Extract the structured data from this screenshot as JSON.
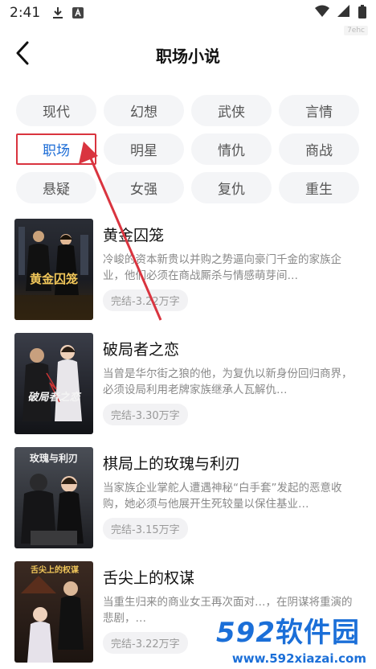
{
  "status_bar": {
    "time": "2:41",
    "watermark_tag": "7ehc"
  },
  "header": {
    "title": "职场小说"
  },
  "tags": [
    {
      "label": "现代",
      "active": false
    },
    {
      "label": "幻想",
      "active": false
    },
    {
      "label": "武侠",
      "active": false
    },
    {
      "label": "言情",
      "active": false
    },
    {
      "label": "职场",
      "active": true
    },
    {
      "label": "明星",
      "active": false
    },
    {
      "label": "情仇",
      "active": false
    },
    {
      "label": "商战",
      "active": false
    },
    {
      "label": "悬疑",
      "active": false
    },
    {
      "label": "女强",
      "active": false
    },
    {
      "label": "复仇",
      "active": false
    },
    {
      "label": "重生",
      "active": false
    }
  ],
  "books": [
    {
      "title": "黄金囚笼",
      "desc": "冷峻的资本新贵以并购之势逼向豪门千金的家族企业，他们必须在商战厮杀与情感萌芽间…",
      "status": "完结-3.22万字",
      "cover_text": "黄金囚笼"
    },
    {
      "title": "破局者之恋",
      "desc": "当曾是华尔街之狼的他，为复仇以新身份回归商界，必须设局利用老牌家族继承人瓦解仇…",
      "status": "完结-3.30万字",
      "cover_text": "破局者之恋"
    },
    {
      "title": "棋局上的玫瑰与利刃",
      "desc": "当家族企业掌舵人遭遇神秘“白手套”发起的恶意收购，她必须与他展开生死较量以保住基业…",
      "status": "完结-3.15万字",
      "cover_text": "玫瑰与利刃"
    },
    {
      "title": "舌尖上的权谋",
      "desc": "当重生归来的商业女王再次面对…，在阴谋将重演的悲剧，…",
      "status": "完结-3.22万字",
      "cover_text": "舌尖上的权谋"
    }
  ],
  "site_banner": {
    "logo_digits": "592",
    "logo_text": "软件园",
    "url": "www.592xiazai.com"
  },
  "colors": {
    "active_tag_text": "#1a6bd6",
    "highlight_red": "#d9343f",
    "site_blue": "#1b6fd8"
  }
}
